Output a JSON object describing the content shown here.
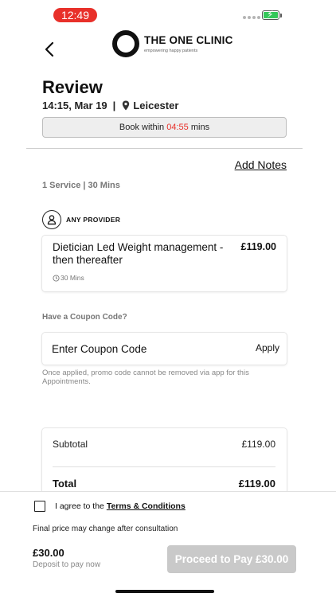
{
  "status_bar": {
    "time": "12:49"
  },
  "header": {
    "logo_name": "THE ONE CLINIC",
    "logo_tagline": "empowering happy patients"
  },
  "review": {
    "title": "Review",
    "time_date": "14:15, Mar 19",
    "separator": "|",
    "location": "Leicester",
    "book_within_prefix": "Book within",
    "book_within_timer": "04:55",
    "book_within_suffix": "mins"
  },
  "notes": {
    "add_notes_label": "Add Notes"
  },
  "summary": {
    "services_label": "1 Service | 30 Mins"
  },
  "provider": {
    "label": "ANY PROVIDER"
  },
  "service": {
    "name": "Dietician Led Weight management - then thereafter",
    "price": "£119.00",
    "duration": "30 Mins"
  },
  "coupon": {
    "heading": "Have a Coupon Code?",
    "placeholder": "Enter Coupon Code",
    "apply_label": "Apply",
    "note": "Once applied, promo code cannot be removed via app for this Appointments."
  },
  "totals": {
    "subtotal_label": "Subtotal",
    "subtotal_value": "£119.00",
    "total_label": "Total",
    "total_value": "£119.00"
  },
  "footer": {
    "terms_prefix": "I agree to the",
    "terms_link": "Terms & Conditions",
    "final_price_note": "Final price may change after consultation",
    "deposit_amount": "£30.00",
    "deposit_label": "Deposit to pay now",
    "pay_button_label": "Proceed to Pay £30.00"
  },
  "colors": {
    "accent_red": "#e8302a",
    "disabled_button": "#c9c9c9",
    "battery_green": "#34c759"
  },
  "icons": [
    "back-arrow-icon",
    "location-pin-icon",
    "person-icon",
    "clock-icon",
    "battery-icon",
    "signal-icon"
  ]
}
